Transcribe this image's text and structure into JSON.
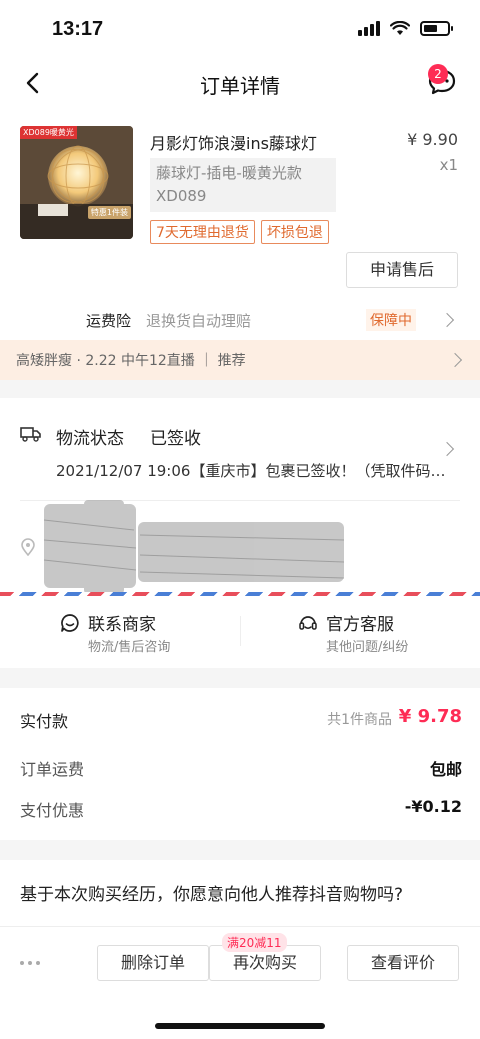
{
  "status_bar": {
    "time": "13:17"
  },
  "nav": {
    "title": "订单详情",
    "message_badge": "2"
  },
  "product": {
    "image_label": "XD089暖黄光",
    "image_badge": "特惠1件装",
    "title": "月影灯饰浪漫ins藤球灯",
    "sku": "藤球灯-插电-暖黄光款XD089",
    "price": "¥ 9.90",
    "quantity": "x1",
    "tags": [
      "7天无理由退货",
      "坏损包退"
    ],
    "after_sale_button": "申请售后",
    "insurance_label": "运费险",
    "insurance_desc": "退换货自动理赔",
    "insurance_status": "保障中"
  },
  "live_banner": {
    "text": "高矮胖瘦 · 2.22 中午12直播 ｜ 推荐"
  },
  "logistics": {
    "label": "物流状态",
    "status": "已签收",
    "detail": "2021/12/07 19:06【重庆市】包裹已签收！（凭取件码…"
  },
  "contact": {
    "merchant_title": "联系商家",
    "merchant_sub": "物流/售后咨询",
    "service_title": "官方客服",
    "service_sub": "其他问题/纠纷"
  },
  "payment": {
    "paid_label": "实付款",
    "item_count": "共1件商品",
    "paid_total": "¥ 9.78",
    "shipping_label": "订单运费",
    "shipping_value": "包邮",
    "discount_label": "支付优惠",
    "discount_value": "-¥0.12"
  },
  "survey": {
    "question": "基于本次购买经历，你愿意向他人推荐抖音购物吗?"
  },
  "bottom_bar": {
    "delete_button": "删除订单",
    "rebuy_button": "再次购买",
    "rebuy_promo": "满20减11",
    "review_button": "查看评价"
  },
  "colors": {
    "accent": "#fe2c55",
    "tag": "#e06a2f",
    "banner_bg": "#fdeee3"
  }
}
